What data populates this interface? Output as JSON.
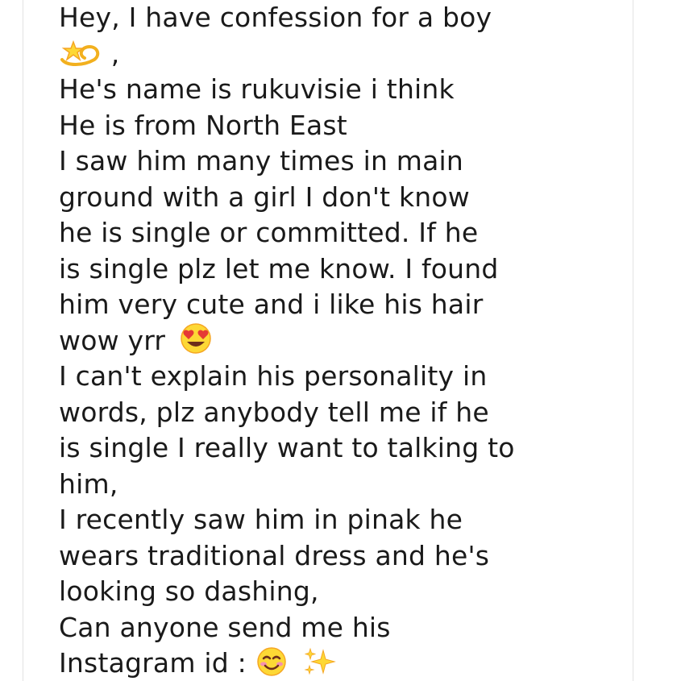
{
  "message": {
    "lines": [
      "Hey, I have confession for a boy",
      ",",
      "He's name is rukuvisie i think",
      "He is from North East",
      "I saw him many times in main",
      "ground with a girl I don't know",
      "he is single or committed. If he",
      "is single plz let me know. I found",
      "him very cute and i like his hair",
      "wow yrr",
      "I can't explain his personality in",
      "words, plz anybody tell me if he",
      "is single I really want to talking to",
      "him,",
      "I recently saw him in pinak he",
      "wears traditional dress and he's",
      "looking so dashing,",
      "Can anyone send me his",
      "Instagram id :"
    ]
  },
  "emojis": {
    "dizzy": "dizzy-icon",
    "heart_eyes": "heart-eyes-icon",
    "smiling_face": "smiling-face-icon",
    "sparkles": "sparkles-icon"
  },
  "colors": {
    "text": "#1a1a1a",
    "card_border": "#e3e3e3",
    "background": "#ffffff"
  }
}
